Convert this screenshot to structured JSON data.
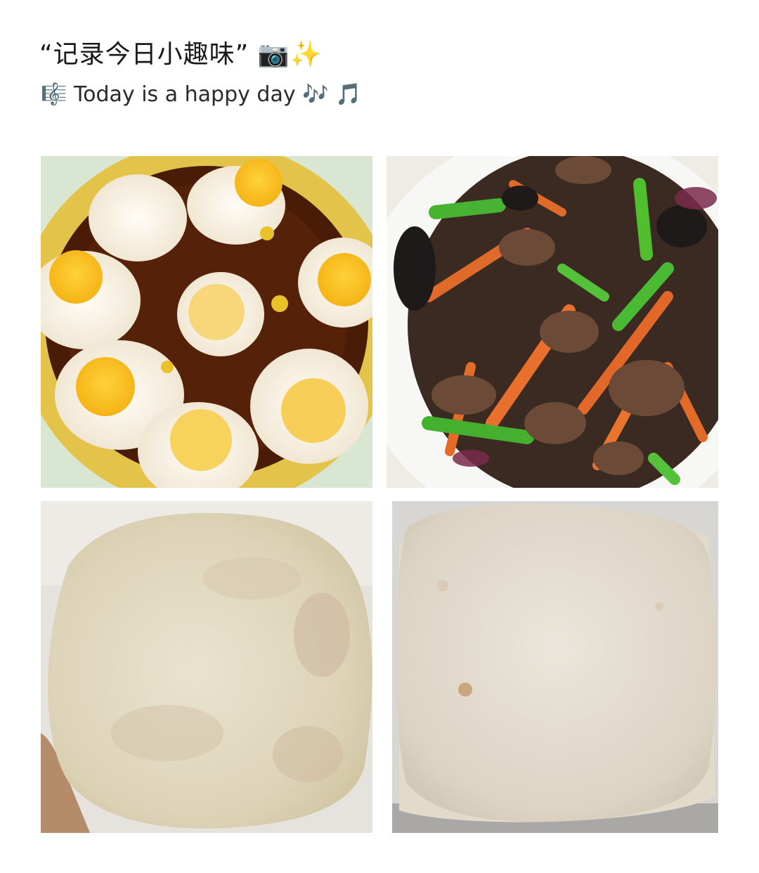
{
  "header": {
    "title": "“记录今日小趣味”",
    "title_emojis": "📷✨",
    "subtitle_prefix_emoji": "🎼",
    "subtitle": "Today is a happy day",
    "subtitle_suffix_emojis": "🎶 🎵"
  },
  "photos": [
    {
      "name": "fried-quail-eggs-photo"
    },
    {
      "name": "stir-fried-beef-vegetables-photo"
    },
    {
      "name": "flatbread-in-hand-photo"
    },
    {
      "name": "stacked-pancakes-photo"
    }
  ]
}
